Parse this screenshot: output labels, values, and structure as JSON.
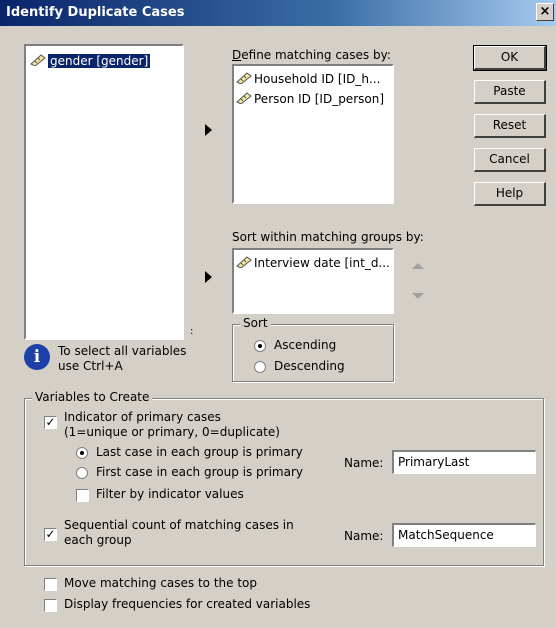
{
  "window": {
    "title": "Identify Duplicate Cases",
    "close_glyph": "×"
  },
  "source_list": {
    "items": [
      {
        "label": "gender [gender]",
        "icon": "ruler-icon"
      }
    ]
  },
  "matching": {
    "label": "Define matching cases by:",
    "items": [
      {
        "label": "Household ID [ID_h...",
        "icon": "ruler-icon"
      },
      {
        "label": "Person ID [ID_person]",
        "icon": "ruler-icon"
      }
    ]
  },
  "sorting": {
    "label": "Sort within matching groups by:",
    "items": [
      {
        "label": "Interview date [int_d...",
        "icon": "ruler-icon"
      }
    ],
    "group_label": "Sort",
    "ascending": "Ascending",
    "descending": "Descending",
    "selected": "ascending"
  },
  "buttons": {
    "ok": "OK",
    "paste": "Paste",
    "reset": "Reset",
    "cancel": "Cancel",
    "help": "Help"
  },
  "info": {
    "line1": "To select all variables",
    "line2": "use Ctrl+A",
    "icon": "info-icon"
  },
  "variables_to_create": {
    "group_label": "Variables to Create",
    "indicator_label_1": "Indicator of primary cases",
    "indicator_label_2": "(1=unique or primary, 0=duplicate)",
    "indicator_checked": true,
    "last_case": "Last case in each group is primary",
    "first_case": "First case in each group is primary",
    "primary_selected": "last",
    "filter_label": "Filter by indicator values",
    "filter_checked": false,
    "name_label": "Name:",
    "primary_name": "PrimaryLast",
    "sequential_label_1": "Sequential count of matching cases in",
    "sequential_label_2": "each group",
    "sequential_checked": true,
    "sequence_name_label": "Name:",
    "sequence_name": "MatchSequence"
  },
  "options": {
    "move_matching": "Move matching cases to the top",
    "move_checked": false,
    "display_freq": "Display frequencies for created variables",
    "display_checked": false
  },
  "colors": {
    "selection": "#0a246a",
    "dialog_bg": "#d4d0c8",
    "title_start": "#0a246a",
    "title_end": "#a6caf0"
  }
}
